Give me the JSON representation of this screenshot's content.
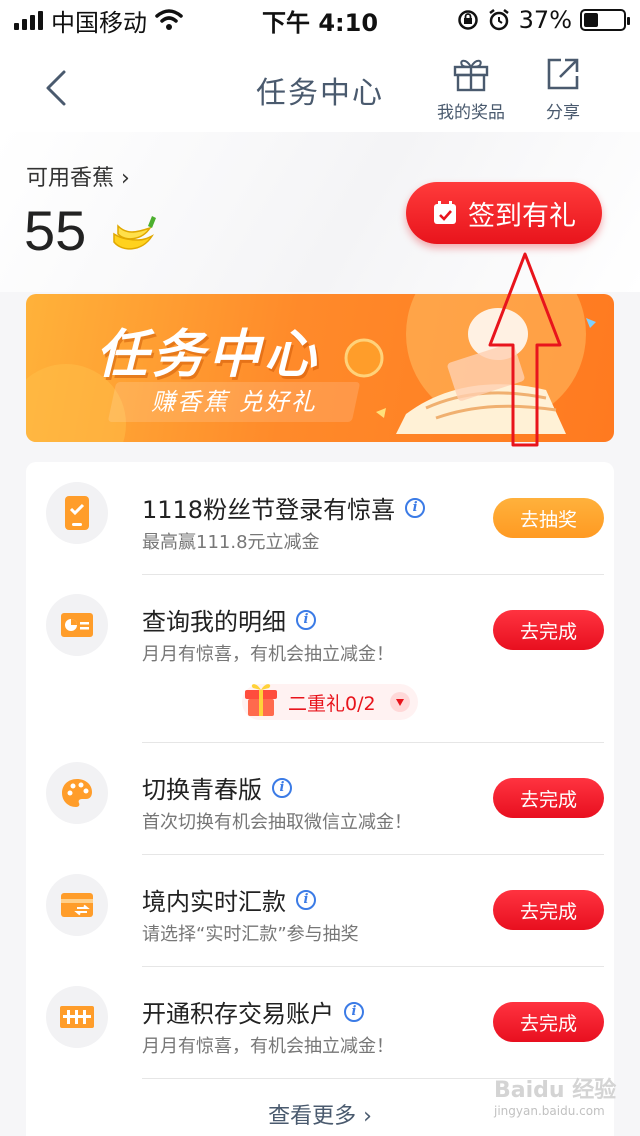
{
  "status_bar": {
    "carrier": "中国移动",
    "time": "下午 4:10",
    "battery": "37%",
    "battery_level": 0.37
  },
  "nav": {
    "title": "任务中心",
    "prizes_label": "我的奖品",
    "share_label": "分享"
  },
  "balance": {
    "label": "可用香蕉",
    "value": "55"
  },
  "sign_in_label": "签到有礼",
  "banner": {
    "title": "任务中心",
    "subtitle": "赚香蕉 兑好礼"
  },
  "tasks": [
    {
      "title": "1118粉丝节登录有惊喜",
      "subtitle": "最高赢111.8元立减金",
      "button": "去抽奖",
      "icon": "phone-check-icon"
    },
    {
      "title": "查询我的明细",
      "subtitle": "月月有惊喜，有机会抽立减金！",
      "button": "去完成",
      "icon": "statement-icon"
    },
    {
      "title": "切换青春版",
      "subtitle": "首次切换有机会抽取微信立减金！",
      "button": "去完成",
      "icon": "palette-icon"
    },
    {
      "title": "境内实时汇款",
      "subtitle": "请选择“实时汇款”参与抽奖",
      "button": "去完成",
      "icon": "transfer-card-icon"
    },
    {
      "title": "开通积存交易账户",
      "subtitle": "月月有惊喜，有机会抽立减金！",
      "button": "去完成",
      "icon": "gold-bars-icon"
    }
  ],
  "bonus_label": "二重礼0/2",
  "more_label": "查看更多",
  "watermark": {
    "main": "Baidu 经验",
    "sub": "jingyan.baidu.com"
  },
  "colors": {
    "accent_red": "#e8141c",
    "accent_orange": "#ff9a22",
    "nav_text": "#4a5a6e",
    "info_blue": "#3b7be6"
  }
}
